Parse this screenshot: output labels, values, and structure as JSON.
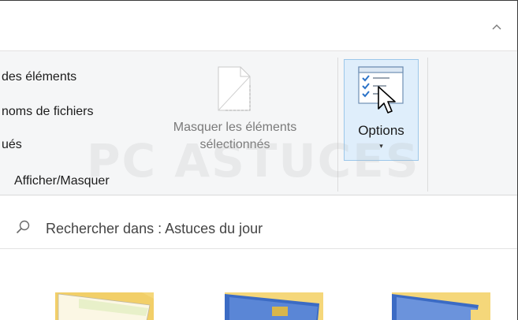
{
  "ribbon": {
    "show_hide_items": [
      {
        "label": "des éléments"
      },
      {
        "label": "noms de fichiers"
      },
      {
        "label": "ués"
      }
    ],
    "hide_selected_button": {
      "line1": "Masquer les éléments",
      "line2": "sélectionnés"
    },
    "options_button": {
      "label": "Options",
      "dropdown_arrow": "▾"
    },
    "group_label": "Afficher/Masquer"
  },
  "watermark": {
    "text": "PC ASTUCES"
  },
  "search": {
    "text": "Rechercher dans : Astuces du jour"
  },
  "icons": {
    "collapse": "chevron-up-icon",
    "hide_selected": "document-dashed-icon",
    "options": "checklist-options-icon",
    "search": "search-icon",
    "cursor": "mouse-pointer-icon"
  },
  "colors": {
    "options_highlight_bg": "#dfeefb",
    "options_highlight_border": "#9cc7ea",
    "folder_yellow": "#f5d77a",
    "folder_blue": "#3b6bc4"
  }
}
